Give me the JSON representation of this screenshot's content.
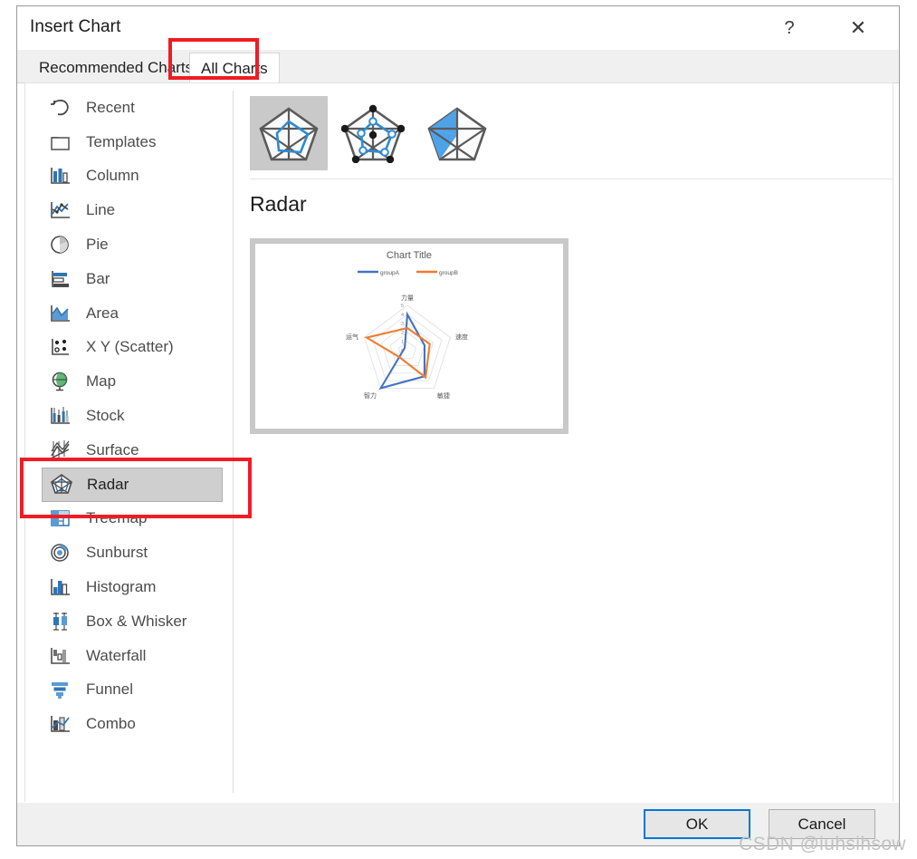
{
  "window": {
    "title": "Insert Chart",
    "help_label": "?",
    "close_label": "✕"
  },
  "tabs": [
    {
      "id": "recommended",
      "label": "Recommended Charts",
      "selected": false
    },
    {
      "id": "all",
      "label": "All Charts",
      "selected": true
    }
  ],
  "sidebar": {
    "items": [
      {
        "label": "Recent",
        "icon": "recent-icon",
        "selected": false
      },
      {
        "label": "Templates",
        "icon": "templates-icon",
        "selected": false
      },
      {
        "label": "Column",
        "icon": "column-icon",
        "selected": false
      },
      {
        "label": "Line",
        "icon": "line-icon",
        "selected": false
      },
      {
        "label": "Pie",
        "icon": "pie-icon",
        "selected": false
      },
      {
        "label": "Bar",
        "icon": "bar-icon",
        "selected": false
      },
      {
        "label": "Area",
        "icon": "area-icon",
        "selected": false
      },
      {
        "label": "X Y (Scatter)",
        "icon": "scatter-icon",
        "selected": false
      },
      {
        "label": "Map",
        "icon": "map-icon",
        "selected": false
      },
      {
        "label": "Stock",
        "icon": "stock-icon",
        "selected": false
      },
      {
        "label": "Surface",
        "icon": "surface-icon",
        "selected": false
      },
      {
        "label": "Radar",
        "icon": "radar-icon",
        "selected": true
      },
      {
        "label": "Treemap",
        "icon": "treemap-icon",
        "selected": false
      },
      {
        "label": "Sunburst",
        "icon": "sunburst-icon",
        "selected": false
      },
      {
        "label": "Histogram",
        "icon": "histogram-icon",
        "selected": false
      },
      {
        "label": "Box & Whisker",
        "icon": "box-whisker-icon",
        "selected": false
      },
      {
        "label": "Waterfall",
        "icon": "waterfall-icon",
        "selected": false
      },
      {
        "label": "Funnel",
        "icon": "funnel-icon",
        "selected": false
      },
      {
        "label": "Combo",
        "icon": "combo-icon",
        "selected": false
      }
    ]
  },
  "main": {
    "chart_type_name": "Radar",
    "subtypes": [
      {
        "name": "radar-subtype-plain",
        "selected": true
      },
      {
        "name": "radar-subtype-markers",
        "selected": false
      },
      {
        "name": "radar-subtype-filled",
        "selected": false
      }
    ]
  },
  "footer": {
    "ok_label": "OK",
    "cancel_label": "Cancel"
  },
  "annotations": [
    {
      "name": "annot-all-charts",
      "target": "All Charts tab"
    },
    {
      "name": "annot-radar",
      "target": "Radar list item"
    }
  ],
  "watermark": {
    "text": "CSDN @iuhsihsow"
  },
  "colors": {
    "series_a": "#4472c4",
    "series_b": "#ed7d31",
    "accent": "#0078d7",
    "annotation": "#ee1c25",
    "selection": "#cfcfcf"
  },
  "chart_data": {
    "type": "radar",
    "title": "Chart Title",
    "categories": [
      "力量",
      "速度",
      "敏捷",
      "智力",
      "运气"
    ],
    "tick_labels": [
      "0",
      "1",
      "2",
      "3",
      "4",
      "5"
    ],
    "rlim": [
      0,
      5
    ],
    "grid": true,
    "legend_position": "top",
    "series": [
      {
        "name": "groupA",
        "color": "#4472c4",
        "values": [
          4,
          2,
          3.2,
          5,
          0.3
        ]
      },
      {
        "name": "groupB",
        "color": "#ed7d31",
        "values": [
          2.5,
          2.6,
          3.3,
          0.4,
          4.6
        ]
      }
    ]
  }
}
